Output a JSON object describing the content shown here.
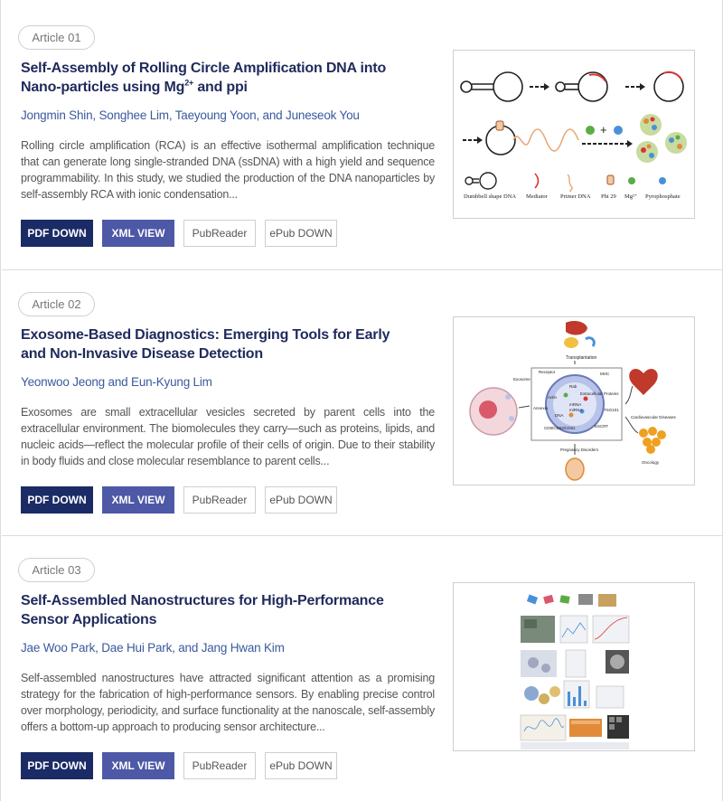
{
  "articles": [
    {
      "badge": "Article 01",
      "title_main": "Self-Assembly of Rolling Circle Amplification DNA into Nano-particles using Mg",
      "title_sup": "2+",
      "title_tail": " and ppi",
      "authors": "Jongmin Shin, Songhee Lim, Taeyoung Yoon, and Juneseok You",
      "abstract": "Rolling circle amplification (RCA) is an effective isothermal amplification technique that can generate long single-stranded DNA (ssDNA) with a high yield and sequence programmability. In this study, we studied the production of the DNA nanoparticles by self-assembly RCA with ionic condensation...",
      "buttons": {
        "pdf": "PDF DOWN",
        "xml": "XML VIEW",
        "pubreader": "PubReader",
        "epub": "ePub DOWN"
      },
      "figure": {
        "legend": [
          "Dumbbell shape DNA",
          "Mediator",
          "Primer DNA",
          "Phi 29",
          "Mg²⁺",
          "Pyrophosphate"
        ]
      }
    },
    {
      "badge": "Article 02",
      "title_main": "Exosome-Based Diagnostics: Emerging Tools for Early and Non-Invasive Disease Detection",
      "title_sup": "",
      "title_tail": "",
      "authors": "Yeonwoo Jeong and Eun-Kyung Lim",
      "abstract": "Exosomes are small extracellular vesicles secreted by parent cells into the extracellular environment. The biomolecules they carry—such as proteins, lipids, and nucleic acids—reflect the molecular profile of their cells of origin. Due to their stability in body fluids and close molecular resemblance to parent cells...",
      "buttons": {
        "pdf": "PDF DOWN",
        "xml": "XML VIEW",
        "pubreader": "PubReader",
        "epub": "ePub DOWN"
      },
      "figure": {
        "labels": [
          "Transplantation",
          "Receptor",
          "MHC",
          "Exosome",
          "Actin",
          "Rab",
          "Extracellular Proteins",
          "Annexin",
          "DNA",
          "mRNA",
          "miRNA",
          "TSG101",
          "CD9/CD63/CD81",
          "ESCRT",
          "Cardiovascular Diseases",
          "Oncology",
          "Pregnancy Disorders"
        ]
      }
    },
    {
      "badge": "Article 03",
      "title_main": "Self-Assembled Nanostructures for High-Performance Sensor Applications",
      "title_sup": "",
      "title_tail": "",
      "authors": "Jae Woo Park, Dae Hui Park, and Jang Hwan Kim",
      "abstract": "Self-assembled nanostructures have attracted significant attention as a promising strategy for the fabrication of high-performance sensors. By enabling precise control over morphology, periodicity, and surface functionality at the nanoscale, self-assembly offers a bottom-up approach to producing sensor architecture...",
      "buttons": {
        "pdf": "PDF DOWN",
        "xml": "XML VIEW",
        "pubreader": "PubReader",
        "epub": "ePub DOWN"
      },
      "figure": {}
    }
  ],
  "colors": {
    "title": "#1f2a5c",
    "authors": "#3a5a9e",
    "pdf_button": "#1a2b66",
    "xml_button": "#4d58a6"
  }
}
